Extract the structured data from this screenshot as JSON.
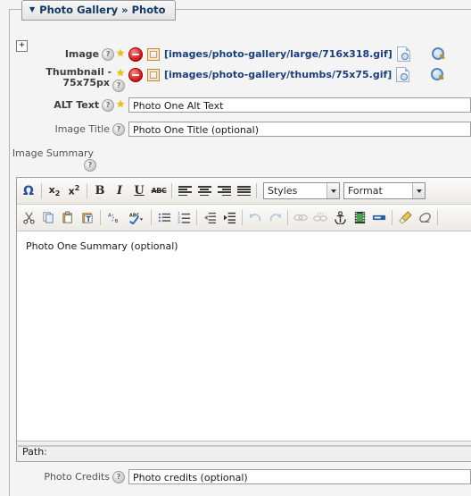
{
  "panel": {
    "tab_caret": "▼",
    "tab_title_main": "Photo Gallery",
    "tab_separator": "»",
    "tab_title_sub": "Photo",
    "expander_label": "+"
  },
  "help_glyph": "?",
  "star_glyph": "★",
  "fields": [
    {
      "label": "Image",
      "required": true,
      "help": true,
      "star": true,
      "value": "[images/photo-gallery/large/716x318.gif]",
      "delete_icon": "delete-icon",
      "thumb_icon": "image-icon",
      "preview_icon": "document-preview-icon",
      "browse_icon": "magnifier-icon"
    },
    {
      "label_line1": "Thumbnail -",
      "label_line2": "75x75px",
      "required": true,
      "help": true,
      "star": true,
      "value": "[images/photo-gallery/thumbs/75x75.gif]",
      "delete_icon": "delete-icon",
      "thumb_icon": "image-icon",
      "preview_icon": "document-preview-icon",
      "browse_icon": "magnifier-icon"
    }
  ],
  "alt_text": {
    "label": "ALT Text",
    "required": true,
    "value": "Photo One Alt Text"
  },
  "image_title": {
    "label": "Image Title",
    "required": false,
    "value": "Photo One Title (optional)"
  },
  "image_summary": {
    "label": "Image Summary",
    "required": false,
    "value": "Photo One Summary (optional)"
  },
  "photo_credits": {
    "label": "Photo Credits",
    "required": false,
    "value": "Photo credits (optional)"
  },
  "editor": {
    "toolbar_row1": [
      {
        "name": "special-character-icon",
        "glyph": "Ω",
        "kind": "omega"
      },
      {
        "name": "divider",
        "kind": "divider"
      },
      {
        "name": "subscript-icon",
        "glyph": "x₂",
        "kind": "sub"
      },
      {
        "name": "superscript-icon",
        "glyph": "x²",
        "kind": "sup"
      },
      {
        "name": "divider",
        "kind": "divider"
      },
      {
        "name": "bold-icon",
        "glyph": "B",
        "kind": "bold"
      },
      {
        "name": "italic-icon",
        "glyph": "I",
        "kind": "ital"
      },
      {
        "name": "underline-icon",
        "glyph": "U",
        "kind": "undl"
      },
      {
        "name": "strikethrough-icon",
        "glyph": "ABC",
        "kind": "strike"
      },
      {
        "name": "divider",
        "kind": "divider"
      },
      {
        "name": "align-left-icon",
        "kind": "align-left"
      },
      {
        "name": "align-center-icon",
        "kind": "align-center"
      },
      {
        "name": "align-right-icon",
        "kind": "align-right"
      },
      {
        "name": "align-justify-icon",
        "kind": "align-justify"
      },
      {
        "name": "divider",
        "kind": "divider"
      }
    ],
    "styles_select": "Styles",
    "format_select": "Format",
    "toolbar_row2": [
      {
        "name": "cut-icon",
        "kind": "cut"
      },
      {
        "name": "copy-icon",
        "kind": "copy"
      },
      {
        "name": "paste-icon",
        "kind": "paste"
      },
      {
        "name": "paste-text-icon",
        "kind": "paste-text"
      },
      {
        "name": "divider",
        "kind": "divider"
      },
      {
        "name": "find-replace-icon",
        "kind": "find"
      },
      {
        "name": "spellcheck-icon",
        "kind": "spell"
      },
      {
        "name": "divider",
        "kind": "divider"
      },
      {
        "name": "bulleted-list-icon",
        "kind": "ul"
      },
      {
        "name": "numbered-list-icon",
        "kind": "ol"
      },
      {
        "name": "divider",
        "kind": "divider"
      },
      {
        "name": "outdent-icon",
        "kind": "outdent"
      },
      {
        "name": "indent-icon",
        "kind": "indent"
      },
      {
        "name": "divider",
        "kind": "divider"
      },
      {
        "name": "undo-icon",
        "kind": "undo",
        "disabled": true
      },
      {
        "name": "redo-icon",
        "kind": "redo",
        "disabled": true
      },
      {
        "name": "divider",
        "kind": "divider"
      },
      {
        "name": "link-icon",
        "kind": "link",
        "disabled": true
      },
      {
        "name": "unlink-icon",
        "kind": "unlink",
        "disabled": true
      },
      {
        "name": "anchor-icon",
        "kind": "anchor"
      },
      {
        "name": "media-icon",
        "kind": "media"
      },
      {
        "name": "flash-icon",
        "kind": "flash"
      },
      {
        "name": "divider",
        "kind": "divider"
      },
      {
        "name": "paintbrush-icon",
        "kind": "brush"
      },
      {
        "name": "eraser-icon",
        "kind": "eraser"
      },
      {
        "name": "divider",
        "kind": "divider"
      }
    ],
    "body_text": "Photo One Summary (optional)",
    "path_label": "Path",
    "path_colon": ":",
    "path_value": ""
  },
  "colors": {
    "tab_text": "#123a63",
    "link_path": "#1a3f7a",
    "star": "#f2c200",
    "delete": "#d01a1a",
    "accent_blue": "#2a4fa0",
    "page_bg": "#f4f4f4"
  }
}
